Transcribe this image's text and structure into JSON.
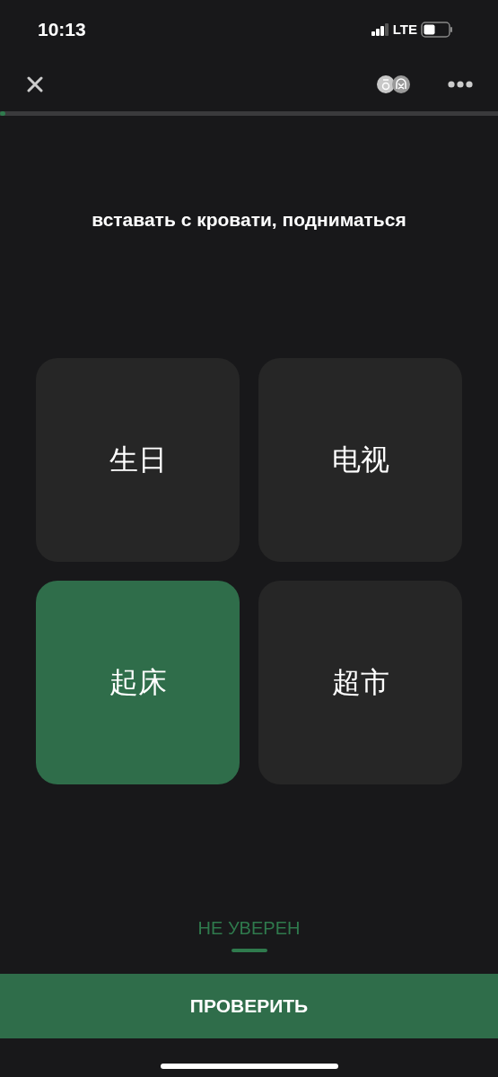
{
  "status_bar": {
    "time": "10:13",
    "network": "LTE"
  },
  "progress": {
    "level": 0.01
  },
  "prompt": "вставать с кровати, подниматься",
  "options": [
    {
      "text": "生日",
      "selected": false
    },
    {
      "text": "电视",
      "selected": false
    },
    {
      "text": "起床",
      "selected": true
    },
    {
      "text": "超市",
      "selected": false
    }
  ],
  "not_sure": "НЕ УВЕРЕН",
  "check_button": "ПРОВЕРИТЬ"
}
